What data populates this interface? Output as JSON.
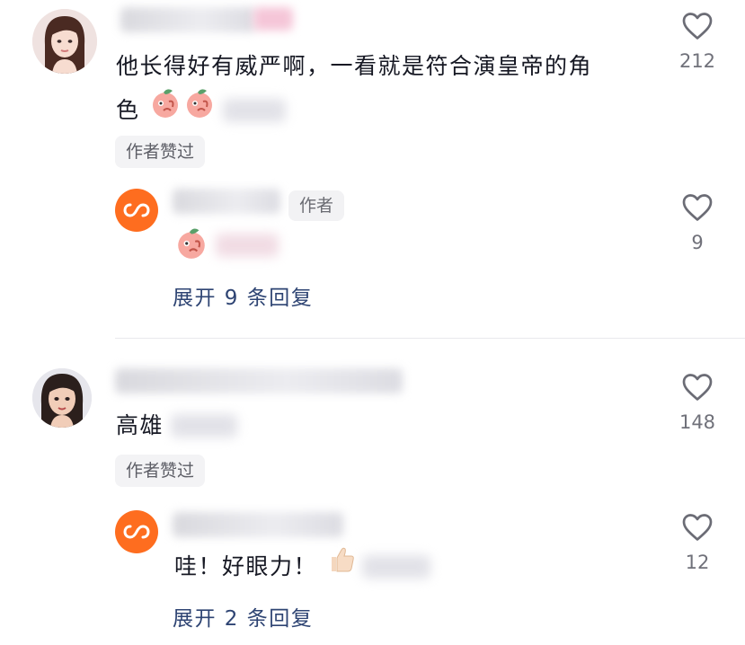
{
  "comments": [
    {
      "text_line1": "他长得好有威严啊，一看就是符合演皇帝的角",
      "text_line2": "色",
      "author_liked": "作者赞过",
      "likes": "212",
      "reply": {
        "author_badge": "作者",
        "likes": "9",
        "expand": "展开 9 条回复"
      }
    },
    {
      "text": "高雄",
      "author_liked": "作者赞过",
      "likes": "148",
      "reply": {
        "text": "哇！好眼力！",
        "likes": "12",
        "expand": "展开 2 条回复"
      }
    }
  ],
  "colors": {
    "accent_orange": "#fe6d1f",
    "link_blue": "#2e4473"
  },
  "icons": [
    "heart-icon",
    "peach-emoji-icon",
    "thumbs-up-emoji-icon",
    "author-avatar-icon"
  ]
}
